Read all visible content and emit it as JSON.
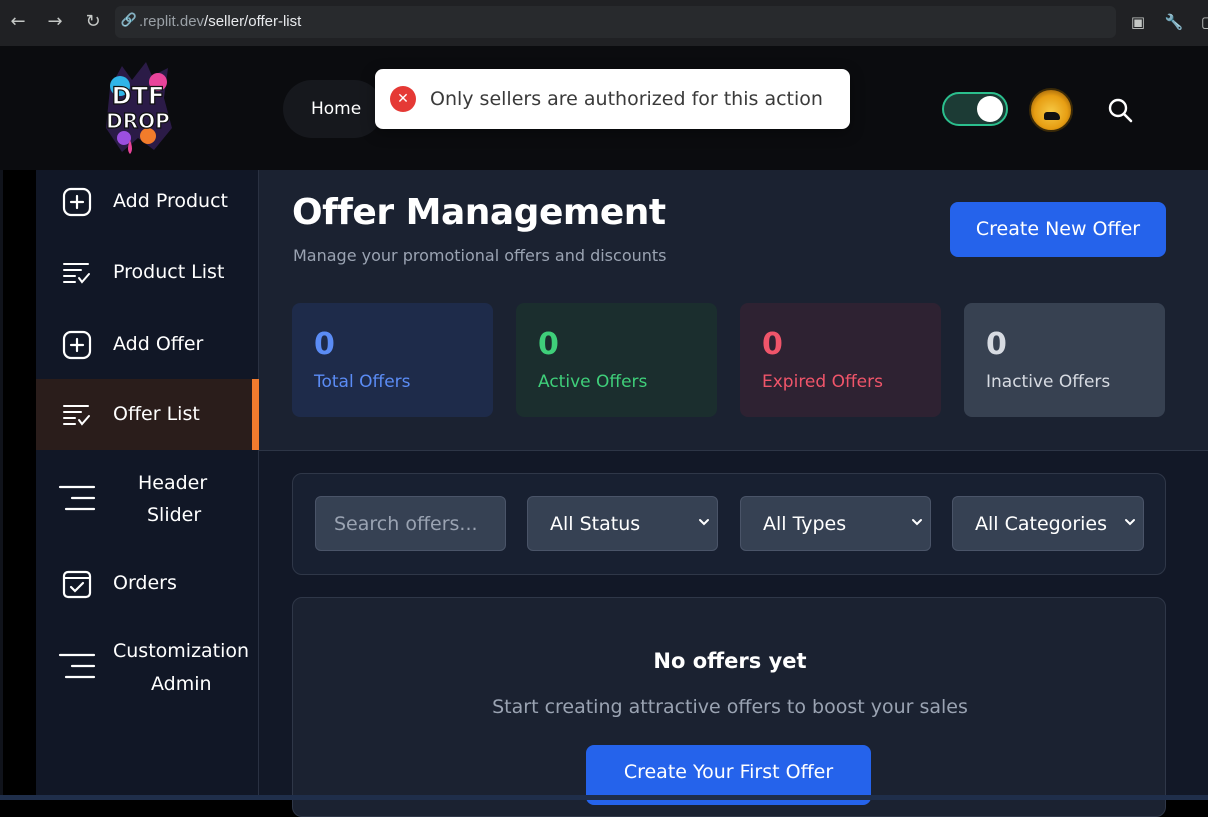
{
  "browser": {
    "url_prefix": ".replit.dev",
    "url_path": "/seller/offer-list"
  },
  "header": {
    "logo_alt": "DTF DROP",
    "nav_home": "Home",
    "theme_toggle_on": true
  },
  "toast": {
    "message": "Only sellers are authorized for this action"
  },
  "sidebar": {
    "items": [
      {
        "label": "Add Product",
        "icon": "plus-square-icon"
      },
      {
        "label": "Product List",
        "icon": "list-check-icon"
      },
      {
        "label": "Add Offer",
        "icon": "plus-square-icon"
      },
      {
        "label": "Offer List",
        "icon": "list-check-icon",
        "active": true
      },
      {
        "label_line1": "Header",
        "label_line2": "Slider",
        "icon": "menu-lines-icon"
      },
      {
        "label": "Orders",
        "icon": "checkbox-icon"
      },
      {
        "label_line1": "Customization",
        "label_line2": "Admin",
        "icon": "menu-lines-icon"
      }
    ]
  },
  "main": {
    "title": "Offer Management",
    "subtitle": "Manage your promotional offers and discounts",
    "create_button": "Create New Offer",
    "stats": [
      {
        "value": "0",
        "label": "Total Offers",
        "color": "#5b8cf5"
      },
      {
        "value": "0",
        "label": "Active Offers",
        "color": "#3fcf7a"
      },
      {
        "value": "0",
        "label": "Expired Offers",
        "color": "#f0556a"
      },
      {
        "value": "0",
        "label": "Inactive Offers",
        "color": "#d7dbe2"
      }
    ],
    "filters": {
      "search_placeholder": "Search offers...",
      "status": "All Status",
      "type": "All Types",
      "category": "All Categories"
    },
    "empty": {
      "title": "No offers yet",
      "subtitle": "Start creating attractive offers to boost your sales",
      "button": "Create Your First Offer"
    }
  }
}
